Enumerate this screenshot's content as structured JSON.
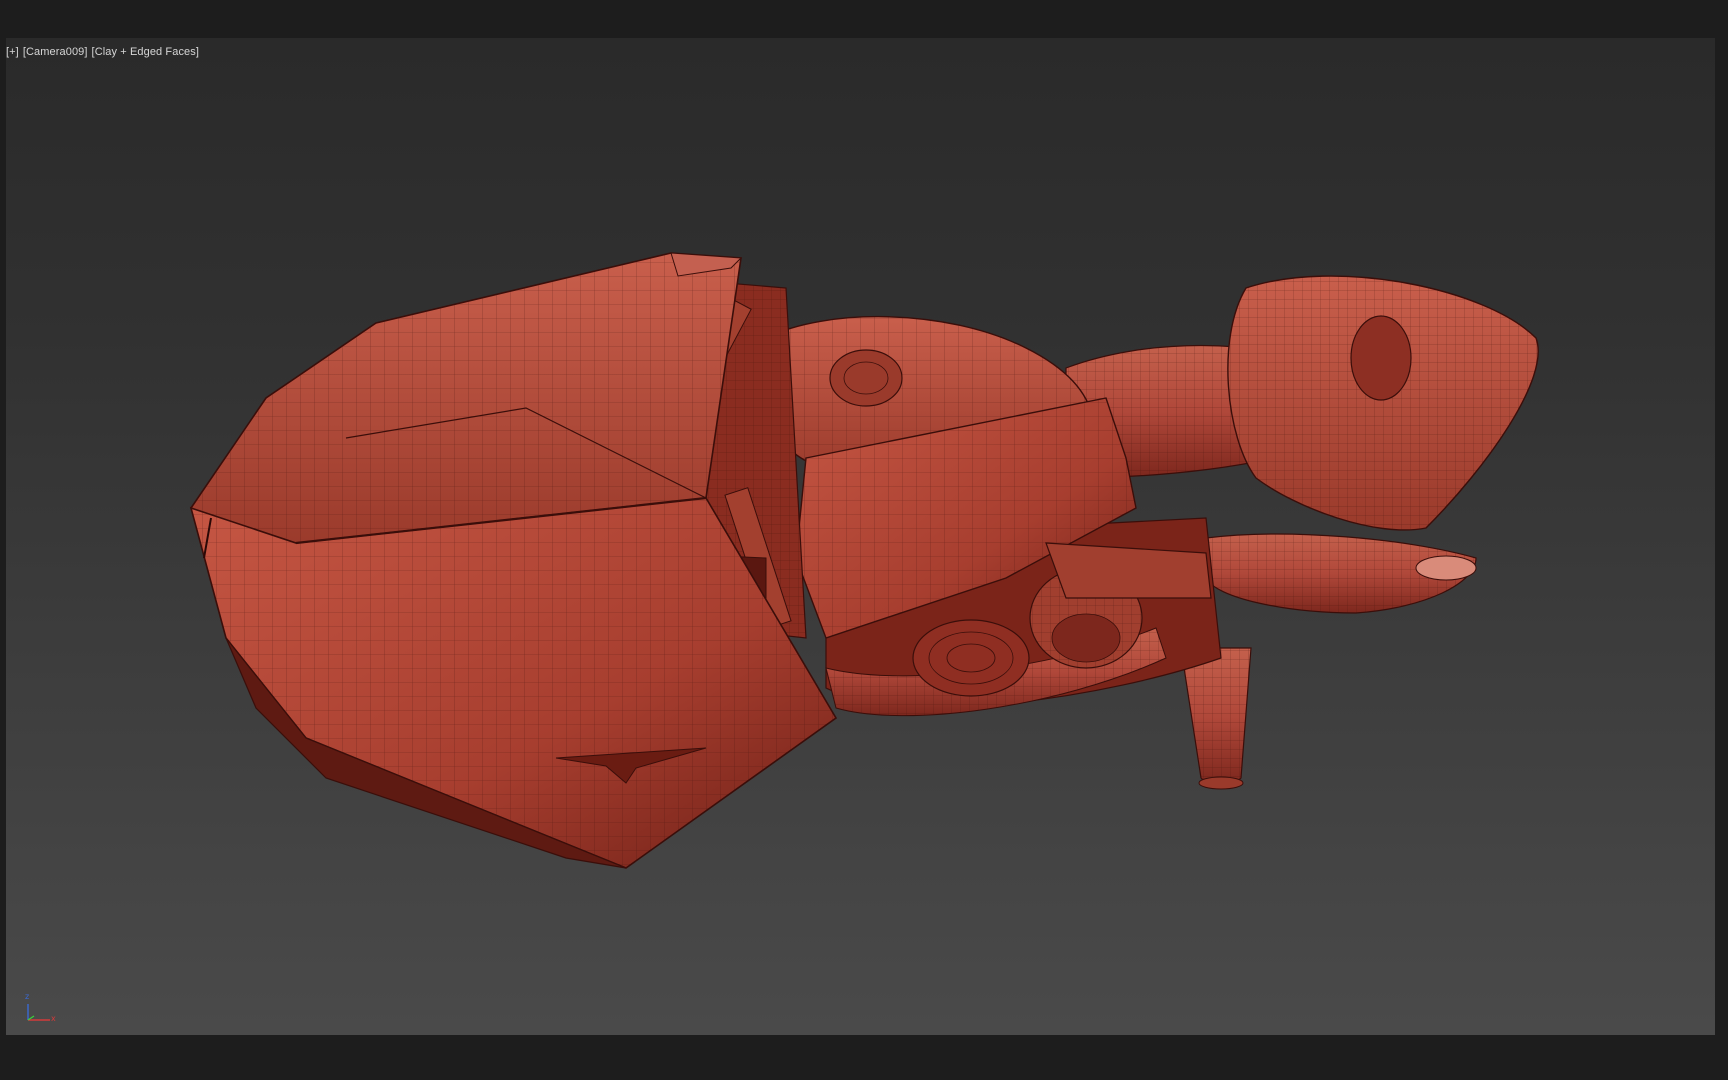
{
  "viewport": {
    "label_plus": "[+]",
    "label_camera": "[Camera009]",
    "label_shading": "[Clay + Edged Faces]"
  },
  "model": {
    "icon": "hover-bike-clay-mesh",
    "clay_color": "#b5483a",
    "wire_color": "#3a0e0a"
  },
  "axis_gizmo": {
    "icon": "axis-tripod-icon",
    "z_label": "z",
    "x_label": "x",
    "x_color": "#d43a3a",
    "z_color": "#3a6ad4",
    "y_color": "#3ad43a"
  },
  "colors": {
    "app_bg": "#1d1d1d",
    "viewport_top": "#2a2a2a",
    "viewport_bottom": "#4a4a4a",
    "label_text": "#d6d6d6"
  }
}
